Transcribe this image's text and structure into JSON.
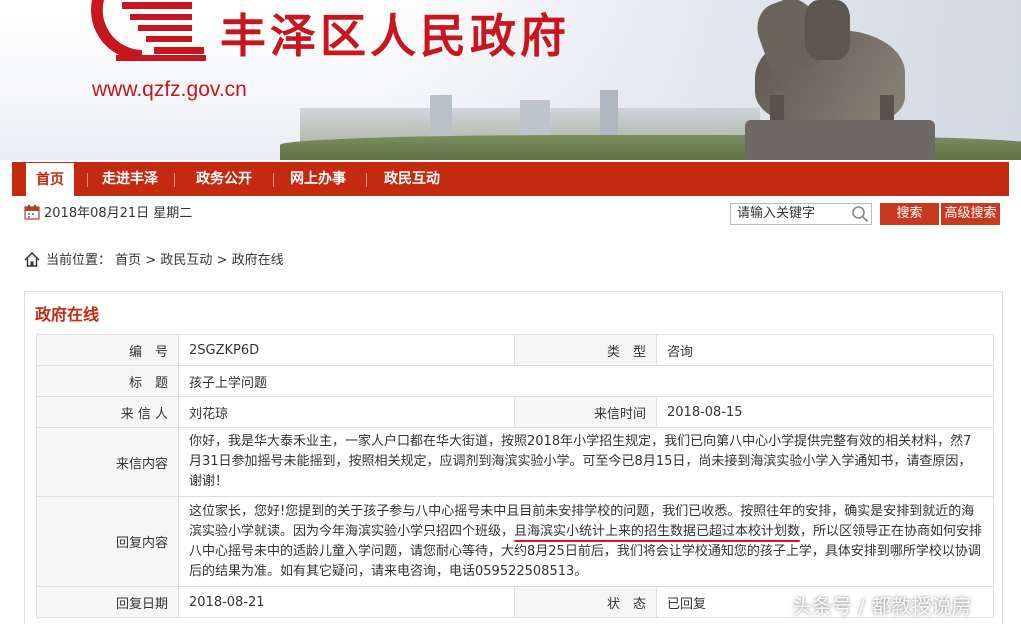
{
  "header": {
    "site_name": "丰泽区人民政府",
    "site_url": "www.qzfz.gov.cn",
    "brand_color": "#c8161e"
  },
  "nav": {
    "items": [
      {
        "label": "首页",
        "active": true
      },
      {
        "label": "走进丰泽",
        "active": false
      },
      {
        "label": "政务公开",
        "active": false
      },
      {
        "label": "网上办事",
        "active": false
      },
      {
        "label": "政民互动",
        "active": false
      }
    ],
    "color": "#c42a10"
  },
  "date_bar": {
    "icon": "calendar-icon",
    "date_text": "2018年08月21日 星期二"
  },
  "search": {
    "value": "请输入关键字",
    "icon": "search-icon",
    "search_label": "搜索",
    "advanced_label": "高级搜索"
  },
  "breadcrumb": {
    "icon": "home-icon",
    "prefix": "当前位置：",
    "items": [
      "首页",
      "政民互动",
      "政府在线"
    ],
    "separator": ">"
  },
  "panel": {
    "title": "政府在线",
    "rows": {
      "number_label": "编　号",
      "number_value": "2SGZKP6D",
      "type_label": "类　型",
      "type_value": "咨询",
      "subject_label": "标　题",
      "subject_value": "孩子上学问题",
      "sender_label": "来 信 人",
      "sender_value": "刘花琼",
      "sent_time_label": "来信时间",
      "sent_time_value": "2018-08-15",
      "content_label": "来信内容",
      "content_value": "你好，我是华大泰禾业主，一家人户口都在华大街道，按照2018年小学招生规定，我们已向第八中心小学提供完整有效的相关材料，然7月31日参加摇号未能摇到，按照相关规定，应调剂到海滨实验小学。可至今已8月15日，尚未接到海滨实验小学入学通知书，请查原因，谢谢！",
      "reply_label": "回复内容",
      "reply_part1": "这位家长，您好!您提到的关于孩子参与八中心摇号未中且目前未安排学校的问题，我们已收悉。按照往年的安排，确实是安排到就近的海滨实验小学就读。因为今年海滨实验小学只招四个班级，",
      "reply_highlight": "且海滨实小统计上来的招生数据已超过本校计划数",
      "reply_part2": "，所以区领导正在协商如何安排八中心摇号未中的适龄儿童入学问题，请您耐心等待，大约8月25日前后，我们将会让学校通知您的孩子上学，具体安排到哪所学校以协调后的结果为准。如有其它疑问，请来电咨询，电话059522508513。",
      "reply_date_label": "回复日期",
      "reply_date_value": "2018-08-21",
      "status_label": "状　态",
      "status_value": "已回复"
    }
  },
  "watermark": "头条号 / 都教授说房"
}
